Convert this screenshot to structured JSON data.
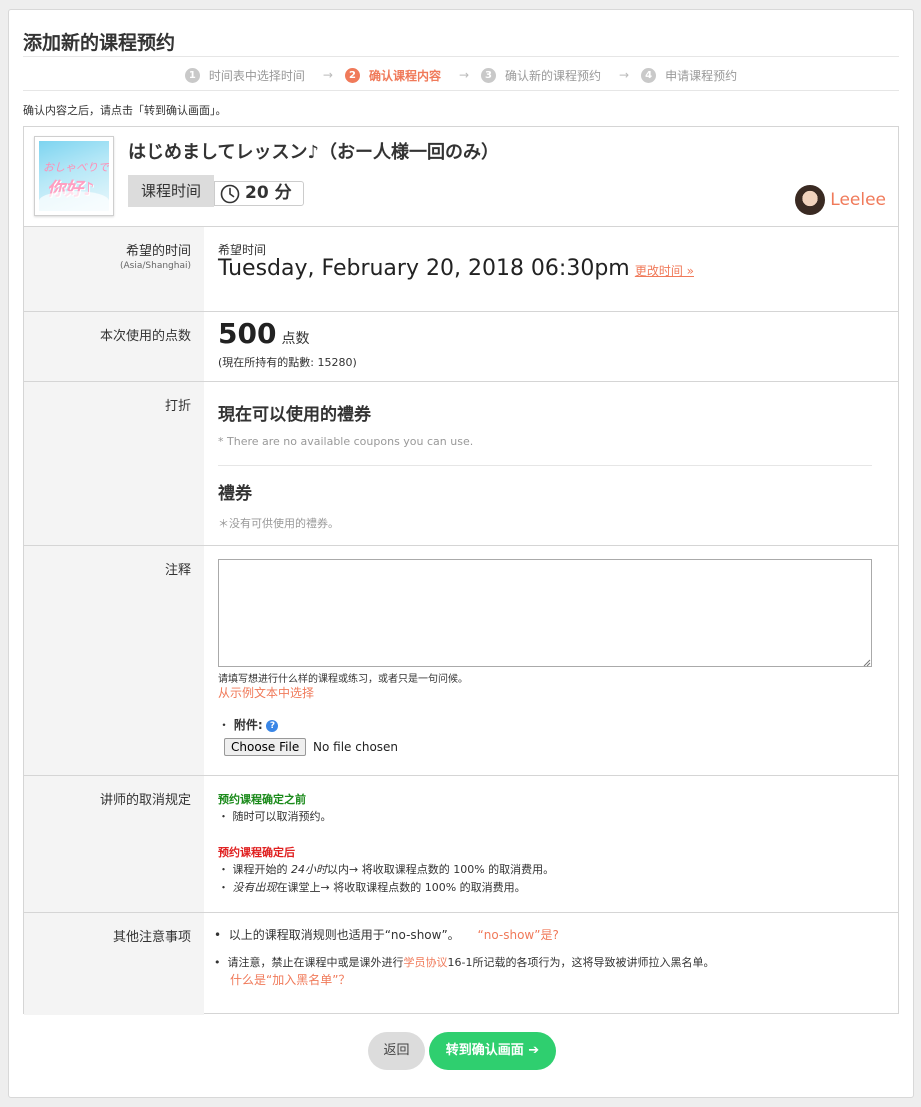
{
  "page": {
    "title": "添加新的课程预约",
    "intro": "确认内容之后，请点击「转到确认画面」。"
  },
  "steps": [
    {
      "num": "1",
      "label": "时间表中选择时间"
    },
    {
      "num": "2",
      "label": "确认课程内容",
      "active": true
    },
    {
      "num": "3",
      "label": "确认新的课程预约"
    },
    {
      "num": "4",
      "label": "申请课程预约"
    }
  ],
  "steps_arrow": "→",
  "lesson": {
    "thumbnail_text_top": "おしゃべりで",
    "thumbnail_text_main": "你好♪",
    "title": "はじめましてレッスン♪（おー人様一回のみ）",
    "duration_label": "课程时间",
    "duration_value": "20 分",
    "clock_icon": "clock-icon",
    "teacher_name": "Leelee"
  },
  "time_row": {
    "label": "希望的时间",
    "timezone": "(Asia/Shanghai)",
    "caption": "希望时间",
    "datetime": "Tuesday, February 20, 2018 06:30pm",
    "change_link": "更改时间 »"
  },
  "points_row": {
    "label": "本次使用的点数",
    "points": "500",
    "unit": "点数",
    "holding": "(現在所持有的點數: 15280)"
  },
  "discount_row": {
    "label": "打折",
    "coupon_heading": "現在可以使用的禮券",
    "coupon_note": "* There are no available coupons you can use.",
    "voucher_heading": "禮券",
    "voucher_note": "＊没有可供使用的禮券。"
  },
  "notes_row": {
    "label": "注释",
    "textarea_value": "",
    "hint": "请填写想进行什么样的课程或练习，或者只是一句问候。",
    "sample_link": "从示例文本中选择",
    "attachment_label": "附件:",
    "help_glyph": "?",
    "file_button": "Choose File",
    "file_status": "No file chosen"
  },
  "cancel_row": {
    "label": "讲师的取消规定",
    "before_heading": "预约课程确定之前",
    "before_item": "随时可以取消预约。",
    "after_heading": "预约课程确定后",
    "after_item1_em": "24小时",
    "after_item1_pre": "课程开始的 ",
    "after_item1_post": "以内→ 将收取课程点数的 100% 的取消费用。",
    "after_item2_em": "没有出现",
    "after_item2_post": "在课堂上→ 将收取课程点数的 100% 的取消费用。"
  },
  "other_row": {
    "label": "其他注意事项",
    "item1": "以上的课程取消规则也适用于“no-show”。",
    "item1_link": "“no-show”是?",
    "item2_pre": "请注意，禁止在课程中或是课外进行",
    "item2_link": "学员协议",
    "item2_post": "16-1所记载的各项行为，这将导致被讲师拉入黑名单。",
    "item2_link2": "什么是“加入黑名单”？"
  },
  "buttons": {
    "back": "返回",
    "next": "转到确认画面 ➔"
  },
  "colors": {
    "accent": "#f07a5a",
    "primary_button": "#2fcf6f",
    "green_heading": "#1a8a1a",
    "red_heading": "#e02020"
  }
}
